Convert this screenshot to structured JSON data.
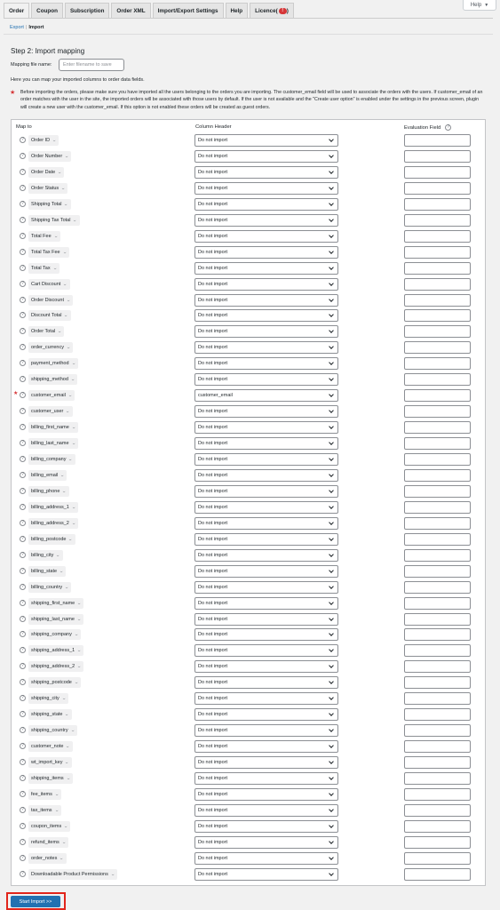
{
  "help_tab": {
    "label": "Help"
  },
  "tabs": [
    {
      "label": "Order",
      "active": true
    },
    {
      "label": "Coupon"
    },
    {
      "label": "Subscription"
    },
    {
      "label": "Order XML"
    },
    {
      "label": "Import/Export Settings"
    },
    {
      "label": "Help"
    },
    {
      "label": "Licence",
      "badge": "!"
    }
  ],
  "subnav": {
    "export": "Export",
    "separator": "|",
    "import": "Import"
  },
  "step_title": "Step 2: Import mapping",
  "mapping_file": {
    "label": "Mapping file name:",
    "placeholder": "Enter filename to save"
  },
  "intro": "Here you can map your imported columns to order data fields.",
  "note": "Before importing the orders, please make sure you have imported all the users belonging to the orders you are importing. The customer_email field will be used to associate the orders with the users. If customer_email of an order matches with the user in the site, the imported orders will be associated with those users by default. If the user is not available and the \"Create user option\" is enabled under the settings in the previous screen, plugin will create a new user with the customer_email. If this option is not enabled these orders will be created as guest orders.",
  "table": {
    "headers": {
      "map_to": "Map to",
      "column_header": "Column Header",
      "evaluation_field": "Evaluation Field"
    },
    "rows": [
      {
        "field": "Order ID",
        "value": "Do not import"
      },
      {
        "field": "Order Number",
        "value": "Do not import"
      },
      {
        "field": "Order Date",
        "value": "Do not import"
      },
      {
        "field": "Order Status",
        "value": "Do not import"
      },
      {
        "field": "Shipping Total",
        "value": "Do not import"
      },
      {
        "field": "Shipping Tax Total",
        "value": "Do not import"
      },
      {
        "field": "Total Fee",
        "value": "Do not import"
      },
      {
        "field": "Total Tax Fee",
        "value": "Do not import"
      },
      {
        "field": "Total Tax",
        "value": "Do not import"
      },
      {
        "field": "Cart Discount",
        "value": "Do not import"
      },
      {
        "field": "Order Discount",
        "value": "Do not import"
      },
      {
        "field": "Discount Total",
        "value": "Do not import"
      },
      {
        "field": "Order Total",
        "value": "Do not import"
      },
      {
        "field": "order_currency",
        "value": "Do not import"
      },
      {
        "field": "payment_method",
        "value": "Do not import"
      },
      {
        "field": "shipping_method",
        "value": "Do not import"
      },
      {
        "field": "customer_email",
        "value": "customer_email",
        "required": true
      },
      {
        "field": "customer_user",
        "value": "Do not import"
      },
      {
        "field": "billing_first_name",
        "value": "Do not import"
      },
      {
        "field": "billing_last_name",
        "value": "Do not import"
      },
      {
        "field": "billing_company",
        "value": "Do not import"
      },
      {
        "field": "billing_email",
        "value": "Do not import"
      },
      {
        "field": "billing_phone",
        "value": "Do not import"
      },
      {
        "field": "billing_address_1",
        "value": "Do not import"
      },
      {
        "field": "billing_address_2",
        "value": "Do not import"
      },
      {
        "field": "billing_postcode",
        "value": "Do not import"
      },
      {
        "field": "billing_city",
        "value": "Do not import"
      },
      {
        "field": "billing_state",
        "value": "Do not import"
      },
      {
        "field": "billing_country",
        "value": "Do not import"
      },
      {
        "field": "shipping_first_name",
        "value": "Do not import"
      },
      {
        "field": "shipping_last_name",
        "value": "Do not import"
      },
      {
        "field": "shipping_company",
        "value": "Do not import"
      },
      {
        "field": "shipping_address_1",
        "value": "Do not import"
      },
      {
        "field": "shipping_address_2",
        "value": "Do not import"
      },
      {
        "field": "shipping_postcode",
        "value": "Do not import"
      },
      {
        "field": "shipping_city",
        "value": "Do not import"
      },
      {
        "field": "shipping_state",
        "value": "Do not import"
      },
      {
        "field": "shipping_country",
        "value": "Do not import"
      },
      {
        "field": "customer_note",
        "value": "Do not import"
      },
      {
        "field": "wt_import_key",
        "value": "Do not import"
      },
      {
        "field": "shipping_items",
        "value": "Do not import"
      },
      {
        "field": "fee_items",
        "value": "Do not import"
      },
      {
        "field": "tax_items",
        "value": "Do not import"
      },
      {
        "field": "coupon_items",
        "value": "Do not import"
      },
      {
        "field": "refund_items",
        "value": "Do not import"
      },
      {
        "field": "order_notes",
        "value": "Do not import"
      },
      {
        "field": "Downloadable Product Permissions",
        "value": "Do not import"
      }
    ]
  },
  "start_button": {
    "label": "Start Import >>"
  },
  "icons": {
    "help": "question-circle-icon",
    "dropdown": "chevron-down-icon",
    "required": "asterisk-icon"
  },
  "colors": {
    "primary": "#2271b1",
    "required": "#d63638",
    "highlight": "#e1251b"
  }
}
